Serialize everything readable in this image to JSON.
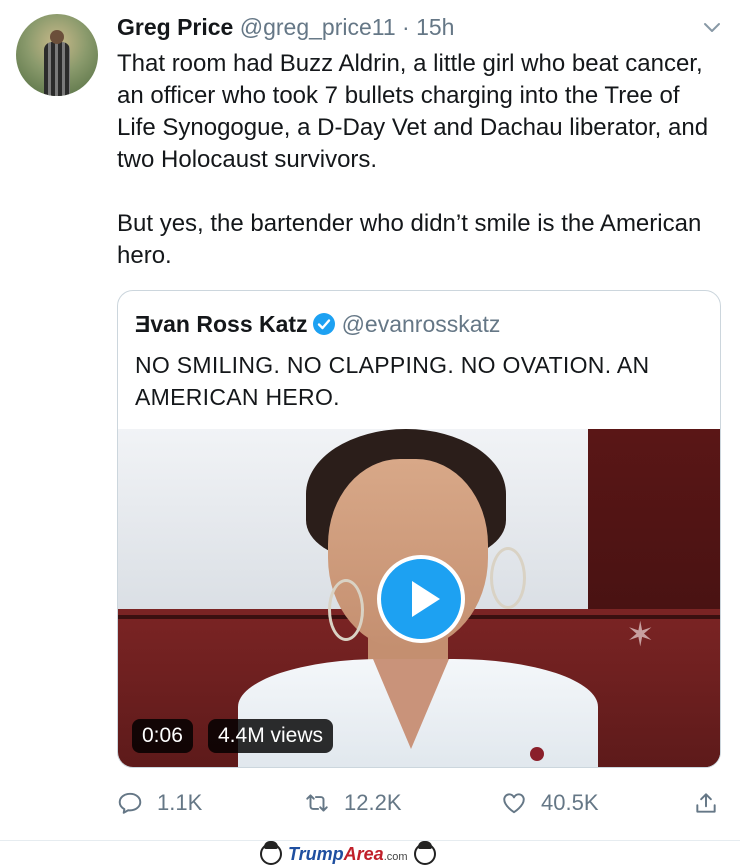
{
  "tweet": {
    "author_name": "Greg Price",
    "author_handle": "@greg_price11",
    "separator": "·",
    "timestamp": "15h",
    "text_paragraph_1": "That room had Buzz Aldrin, a little girl who beat cancer, an officer who took 7 bullets charging into the Tree of Life Synogogue, a D-Day Vet and Dachau liberator, and two Holocaust survivors.",
    "text_paragraph_2": "But yes, the bartender who didn’t smile is the American hero.",
    "icons": {
      "menu": "chevron-down-icon",
      "avatar": "avatar"
    }
  },
  "quoted": {
    "author_name": "Ǝvan Ross Katz",
    "verified_icon": "verified-badge-icon",
    "author_handle": "@evanrosskatz",
    "text": "NO SMILING. NO CLAPPING. NO OVATION. AN AMERICAN HERO.",
    "video": {
      "duration": "0:06",
      "views": "4.4M views",
      "play_icon": "play-icon"
    }
  },
  "actions": {
    "reply_count": "1.1K",
    "retweet_count": "12.2K",
    "like_count": "40.5K",
    "icons": [
      "reply-icon",
      "retweet-icon",
      "like-icon",
      "share-icon"
    ]
  },
  "watermark": {
    "part1": "Trump",
    "part2": "Area",
    "part3": ".com"
  },
  "colors": {
    "accent": "#1da1f2",
    "muted": "#657786",
    "text": "#14171a",
    "border": "#ccd6dd"
  }
}
